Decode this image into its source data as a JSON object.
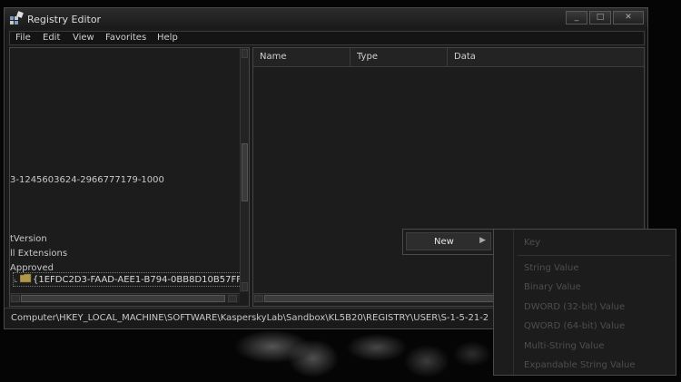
{
  "window": {
    "title": "Registry Editor"
  },
  "title_buttons": {
    "minimize": "_",
    "maximize": "□",
    "close": "✕"
  },
  "menu": [
    "File",
    "Edit",
    "View",
    "Favorites",
    "Help"
  ],
  "tree": {
    "items": [
      "3-1245603624-2966777179-1000",
      "tVersion",
      "ll Extensions",
      "Approved",
      "{1EFDC2D3-FAAD-AEE1-B794-0BB8D10B57FF}"
    ]
  },
  "list": {
    "columns": [
      "Name",
      "Type",
      "Data"
    ]
  },
  "status": {
    "path": "Computer\\HKEY_LOCAL_MACHINE\\SOFTWARE\\KasperskyLab\\Sandbox\\KL5B20\\REGISTRY\\USER\\S-1-5-21-2"
  },
  "context_menu": {
    "new_label": "New",
    "arrow": "▶"
  },
  "submenu": {
    "items": [
      "Key",
      "String Value",
      "Binary Value",
      "DWORD (32-bit) Value",
      "QWORD (64-bit) Value",
      "Multi-String Value",
      "Expandable String Value"
    ]
  },
  "colors": {
    "window_bg": "#1b1b1b",
    "text": "#c8c8c8",
    "disabled_text": "#4e4e4e",
    "highlight": "#2d2d2d"
  }
}
